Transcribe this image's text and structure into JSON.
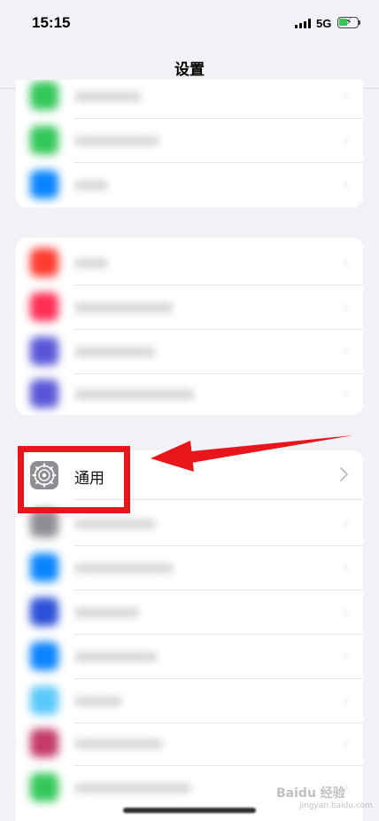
{
  "status_bar": {
    "time": "15:15",
    "network": "5G",
    "battery_icon": "battery-charging-icon"
  },
  "nav": {
    "title": "设置"
  },
  "general_row": {
    "label": "通用",
    "icon": "gear-icon",
    "chevron": "chevron-right-icon"
  },
  "annotation": {
    "box_color": "#e8161a",
    "arrow_color": "#e8161a"
  },
  "blurred_rows": {
    "group1": [
      {
        "icon_color": "#34c759"
      },
      {
        "icon_color": "#34c759"
      },
      {
        "icon_color": "#0a84ff"
      }
    ],
    "group2": [
      {
        "icon_color": "#ff3b30"
      },
      {
        "icon_color": "#ff2d55"
      },
      {
        "icon_color": "#5856d6"
      },
      {
        "icon_color": "#5856d6"
      }
    ],
    "group3": [
      {
        "icon_color": "#8e8e93"
      },
      {
        "icon_color": "#0a84ff"
      },
      {
        "icon_color": "#2b4fd8"
      },
      {
        "icon_color": "#0a84ff"
      },
      {
        "icon_color": "#5ac8fa"
      },
      {
        "icon_color": "#c43a6a"
      },
      {
        "icon_color": "#34c759"
      }
    ]
  },
  "watermark": {
    "text": "Baidu 经验",
    "sub": "jingyan.baidu.com"
  }
}
